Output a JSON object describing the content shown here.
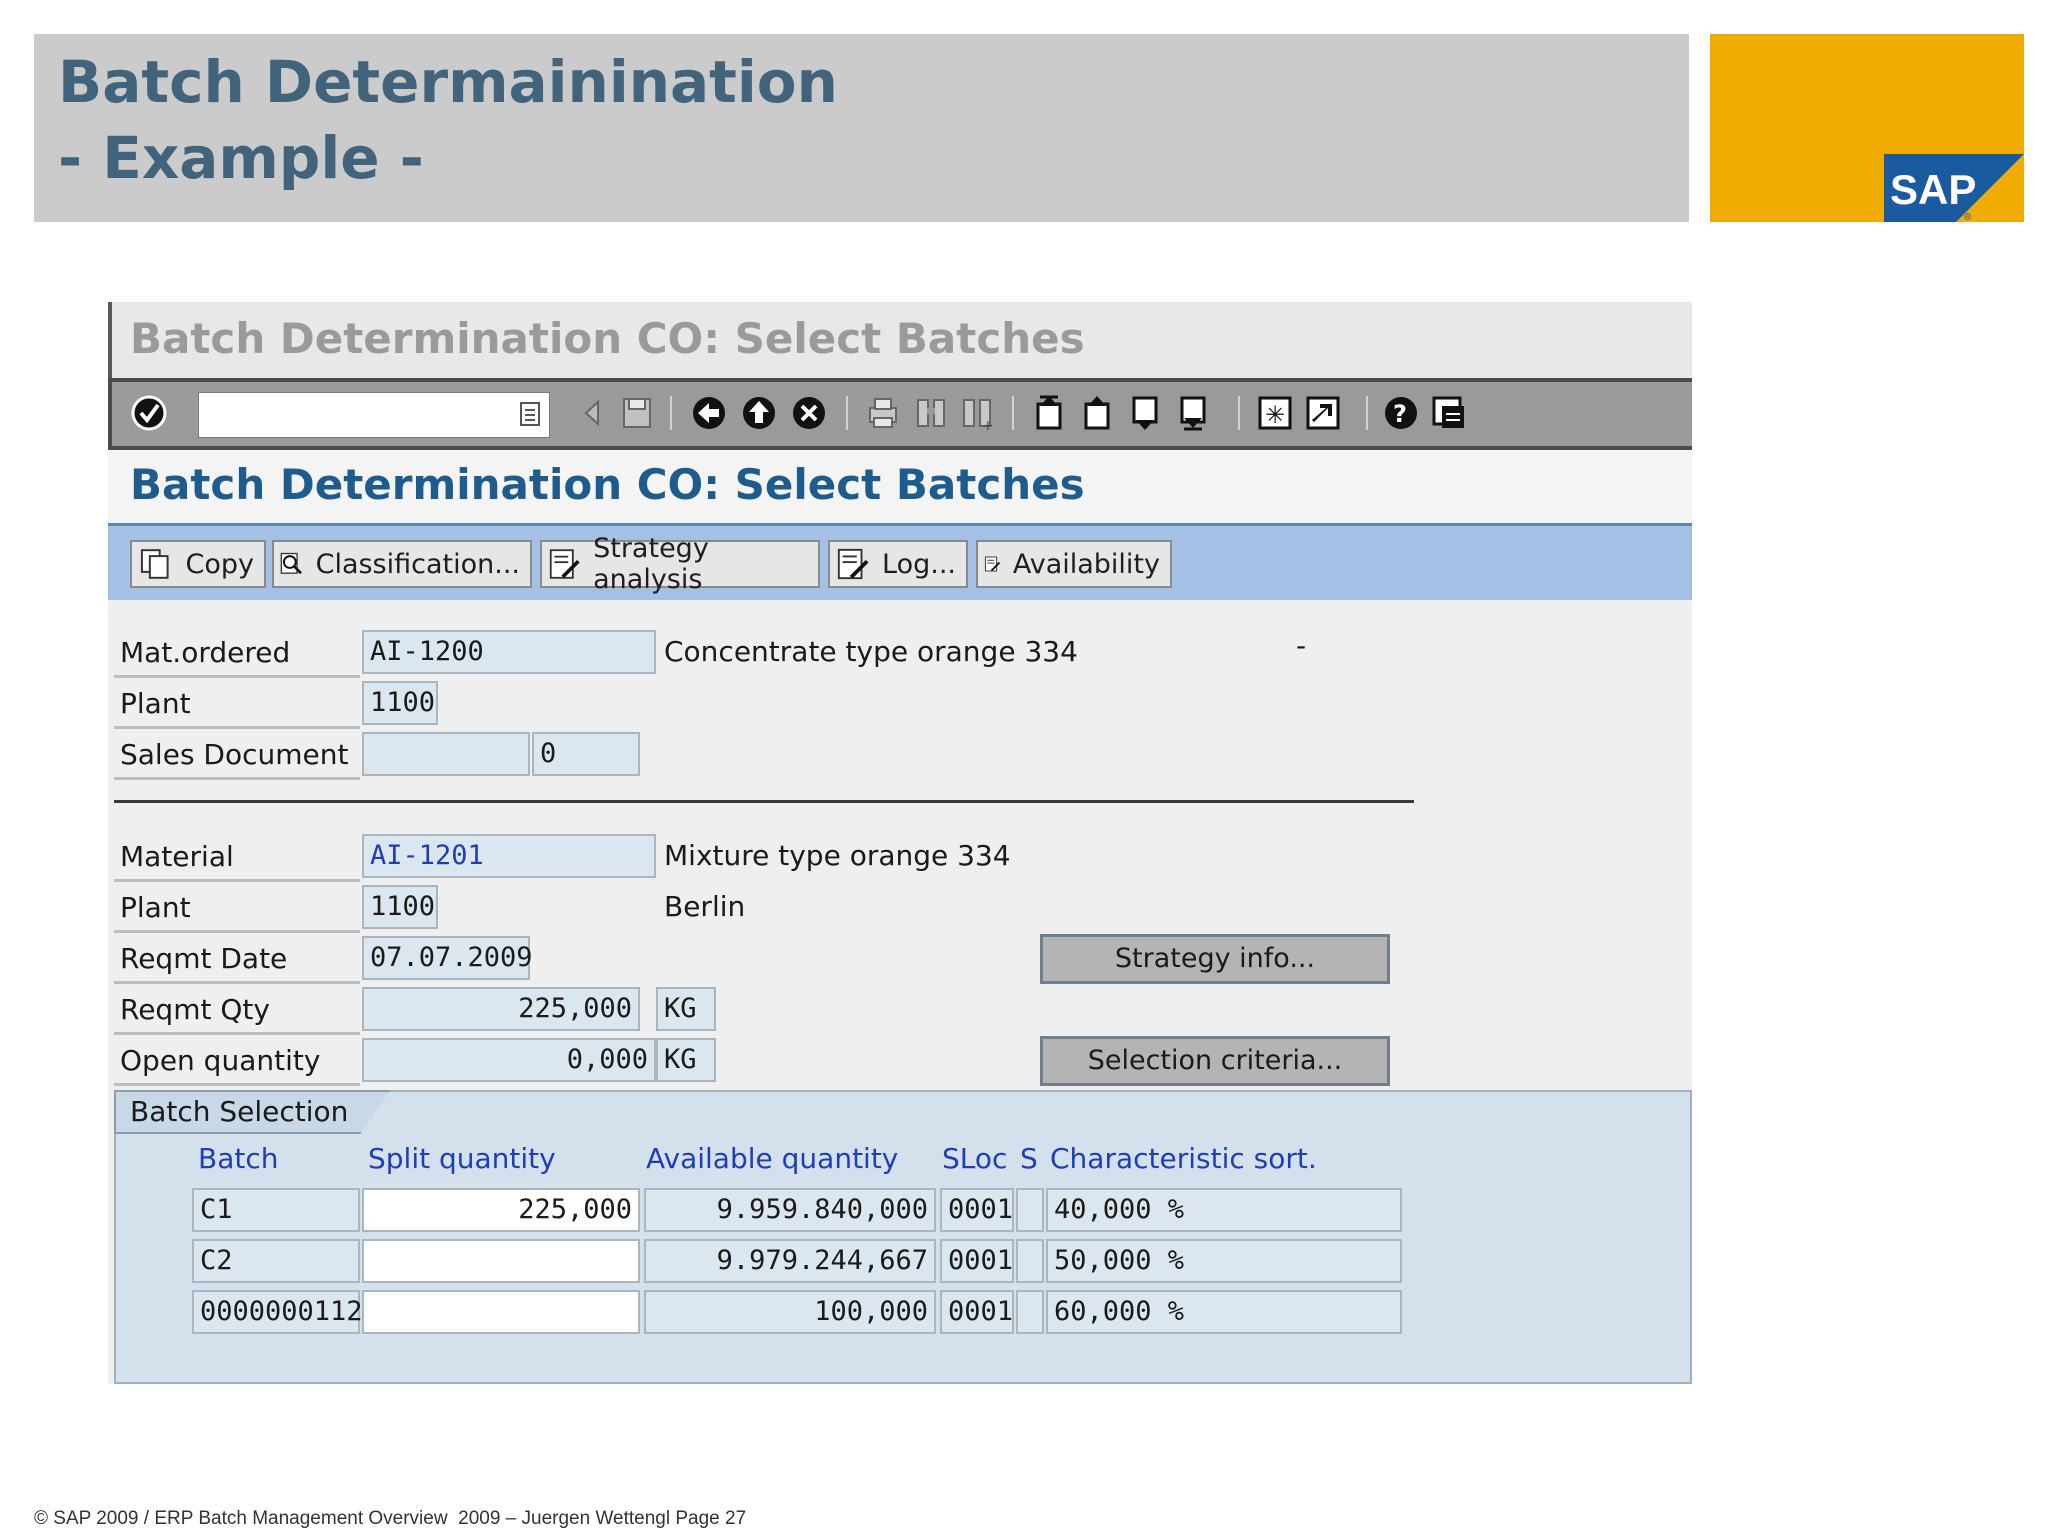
{
  "slide": {
    "title_line1": "Batch Determainination",
    "title_line2": "- Example -",
    "logo_text": "SAP",
    "footer": "© SAP 2009 / ERP Batch Management Overview  2009 – Juergen Wettengl Page 27"
  },
  "window": {
    "title": "Batch Determination CO: Select Batches",
    "screen_title": "Batch Determination CO: Select Batches",
    "command_field": "",
    "toolbar_icons": [
      "enter-icon",
      "command-dropdown-icon",
      "back-arrow-icon",
      "save-icon",
      "back-icon",
      "exit-icon",
      "cancel-icon",
      "print-icon",
      "find-icon",
      "find-next-icon",
      "first-page-icon",
      "previous-page-icon",
      "next-page-icon",
      "last-page-icon",
      "create-session-icon",
      "shortcut-icon",
      "help-icon",
      "layout-menu-icon"
    ]
  },
  "app_toolbar": {
    "copy": "Copy",
    "classification": "Classification...",
    "strategy_analysis": "Strategy analysis",
    "log": "Log...",
    "availability": "Availability"
  },
  "header_section": {
    "mat_ordered_label": "Mat.ordered",
    "mat_ordered_value": "AI-1200",
    "mat_ordered_desc": "Concentrate type orange 334",
    "mat_ordered_dash": "-",
    "plant_label": "Plant",
    "plant_value": "1100",
    "sales_doc_label": "Sales Document",
    "sales_doc_value": "",
    "sales_doc_item": "0"
  },
  "material_section": {
    "material_label": "Material",
    "material_value": "AI-1201",
    "material_desc": "Mixture type orange 334",
    "plant_label": "Plant",
    "plant_value": "1100",
    "plant_desc": "Berlin",
    "reqmt_date_label": "Reqmt Date",
    "reqmt_date_value": "07.07.2009",
    "reqmt_qty_label": "Reqmt Qty",
    "reqmt_qty_value": "225,000",
    "reqmt_qty_unit": "KG",
    "open_qty_label": "Open quantity",
    "open_qty_value": "0,000",
    "open_qty_unit": "KG",
    "strategy_info_button": "Strategy info...",
    "selection_criteria_button": "Selection criteria..."
  },
  "batch_selection": {
    "tab_label": "Batch Selection",
    "headers": {
      "batch": "Batch",
      "split_qty": "Split quantity",
      "available_qty": "Available quantity",
      "sloc": "SLoc",
      "s": "S",
      "char_sort": "Characteristic sort."
    },
    "rows": [
      {
        "batch": "C1",
        "split_qty": "225,000",
        "available_qty": "9.959.840,000",
        "sloc": "0001",
        "s": "",
        "char_sort": "40,000 %"
      },
      {
        "batch": "C2",
        "split_qty": "",
        "available_qty": "9.979.244,667",
        "sloc": "0001",
        "s": "",
        "char_sort": "50,000 %"
      },
      {
        "batch": "0000000112",
        "split_qty": "",
        "available_qty": "100,000",
        "sloc": "0001",
        "s": "",
        "char_sort": "60,000 %"
      }
    ]
  },
  "colors": {
    "title_blue": "#41647c",
    "sap_gold": "#f0ab00",
    "screen_title_blue": "#1f5c8e",
    "app_toolbar_blue": "#a4c0e4",
    "column_head_blue": "#1f3db7"
  }
}
